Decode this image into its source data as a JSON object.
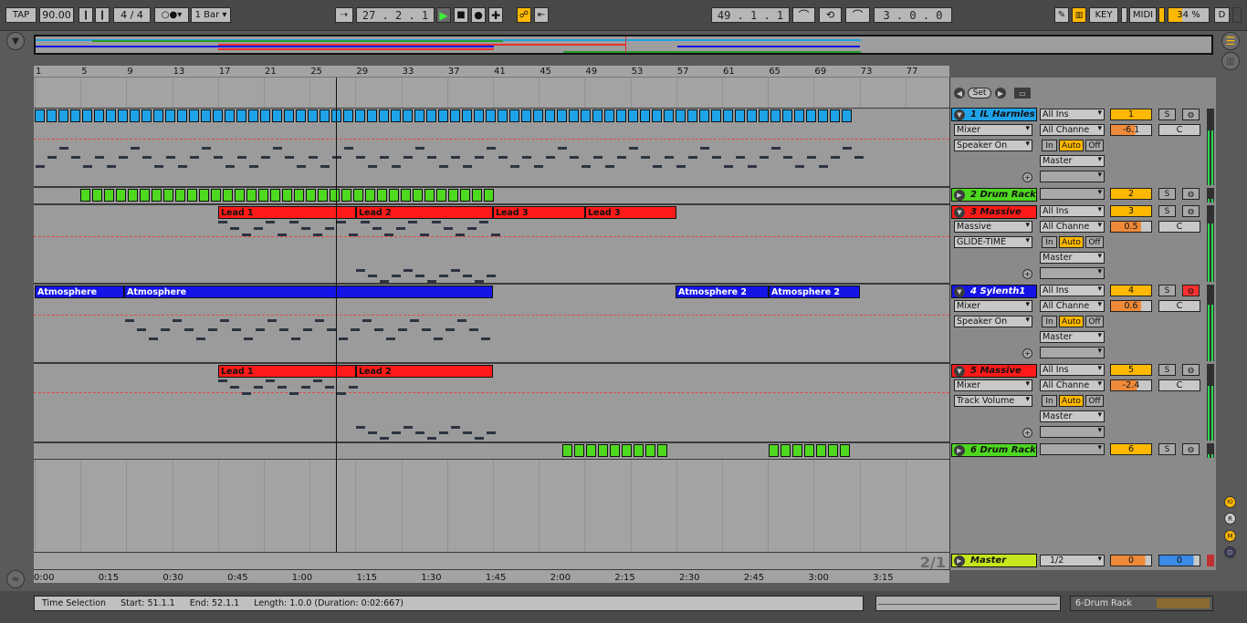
{
  "transport": {
    "tap_label": "TAP",
    "tempo": "90.00",
    "signature": "4 / 4",
    "quantize": "1 Bar",
    "position": "27 .  2 .  1",
    "loop_start": "49 .  1 .  1",
    "loop_length": "3 .  0 .  0",
    "key_label": "KEY",
    "midi_label": "MIDI",
    "cpu": "34 %",
    "d_label": "D"
  },
  "ruler": {
    "bars": [
      "1",
      "5",
      "9",
      "13",
      "17",
      "21",
      "25",
      "29",
      "33",
      "37",
      "41",
      "45",
      "49",
      "53",
      "57",
      "61",
      "65",
      "69",
      "73",
      "77"
    ]
  },
  "timeline": {
    "labels": [
      "0:00",
      "0:15",
      "0:30",
      "0:45",
      "1:00",
      "1:15",
      "1:30",
      "1:45",
      "2:00",
      "2:15",
      "2:30",
      "2:45",
      "3:00",
      "3:15"
    ]
  },
  "loop_controls": {
    "set_label": "Set"
  },
  "tracks": [
    {
      "name": "1 IL Harmles",
      "color": "#1fa3e8",
      "input": "All Ins",
      "channel": "All Channe",
      "device": "Mixer",
      "param": "Speaker On",
      "output": "Master",
      "number": "1",
      "volume": "-6.1",
      "pan": "C"
    },
    {
      "name": "2 Drum Rack",
      "color": "#4ed81f",
      "number": "2"
    },
    {
      "name": "3 Massive",
      "color": "#ff1a1a",
      "input": "All Ins",
      "channel": "All Channe",
      "device": "Massive",
      "param": "GLIDE-TIME",
      "output": "Master",
      "number": "3",
      "volume": "0.5",
      "pan": "C"
    },
    {
      "name": "4 Sylenth1",
      "color": "#1414e6",
      "input": "All Ins",
      "channel": "All Channe",
      "device": "Mixer",
      "param": "Speaker On",
      "output": "Master",
      "number": "4",
      "volume": "0.6",
      "pan": "C"
    },
    {
      "name": "5 Massive",
      "color": "#ff1a1a",
      "input": "All Ins",
      "channel": "All Channe",
      "device": "Mixer",
      "param": "Track Volume",
      "output": "Master",
      "number": "5",
      "volume": "-2.4",
      "pan": "C"
    },
    {
      "name": "6 Drum Rack",
      "color": "#4ed81f",
      "number": "6"
    },
    {
      "name": "Master",
      "color": "#c8e61e",
      "output": "1/2",
      "volume": "0",
      "pan": "0"
    }
  ],
  "monitor": {
    "in": "In",
    "auto": "Auto",
    "off": "Off"
  },
  "solo_label": "S",
  "clips": {
    "massive3": [
      "Lead 1",
      "Lead 2",
      "Lead 3",
      "Lead 3"
    ],
    "sylenth": [
      "Atmosphere",
      "Atmosphere",
      "Atmosphere 2",
      "Atmosphere 2"
    ],
    "massive5": [
      "Lead 1",
      "Lead 2"
    ]
  },
  "page_indicator": "2/1",
  "status": {
    "label": "Time Selection",
    "start": "Start: 51.1.1",
    "end": "End: 52.1.1",
    "length": "Length: 1.0.0  (Duration: 0:02:667)"
  },
  "selected_track": "6-Drum Rack"
}
